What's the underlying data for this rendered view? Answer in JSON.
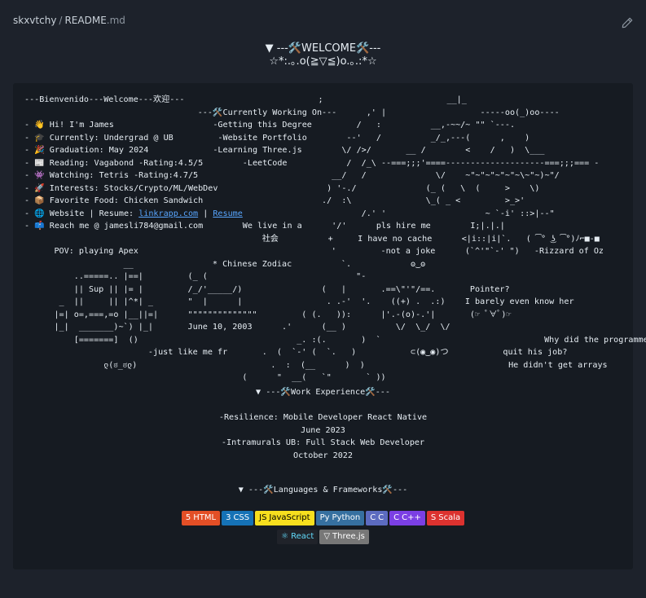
{
  "breadcrumb": {
    "owner": "skxvtchy",
    "separator": "/",
    "file": "README",
    "ext": ".md"
  },
  "header": {
    "title_line": "▼ ---🛠️WELCOME🛠️---",
    "subtitle_line": "☆*:.｡.o(≧▽≦)o.｡.:*☆"
  },
  "art": {
    "line01": "---Bienvenido---Welcome---欢迎---                           ;                         __|_",
    "line02": "                                   ---🛠️Currently Working On---      ,' |                   -----oo(_)oo----",
    "line03": "- 👋 Hi! I'm James                    -Getting this Degree         /   :          __,-~~/~ \"\" `---.",
    "line04": "- 🎓 Currently: Undergrad @ UB         -Website Portfolio        --'   /          _/_,---(      ,    )",
    "line05": "- 🎉 Graduation: May 2024             -Learning Three.js        \\/ />/       __ /        <    /   )  \\___",
    "line06": "- 📰 Reading: Vagabond -Rating:4.5/5        -LeetCode            /  /_\\ --===;;;'====--------------------===;;;=== -",
    "line07": "- 👾 Watching: Tetris -Rating:4.7/5                           __/   /              \\/    ~\"~\"~\"~\"~\"~\\~\"~)~\"/",
    "line08": "- 🚀 Interests: Stocks/Crypto/ML/WebDev                      ) '-./              (_ (   \\  (     >    \\)",
    "line09": "- 📦 Favorite Food: Chicken Sandwich                        ./  :\\               \\_( _ <         >_>'",
    "line10a": "- 🌐 Website | Resume: ",
    "link1": "linkrapp.com",
    "line10b": " | ",
    "link2": "Resume",
    "line10c": "                        /.' '                    ~ `-i' ::>|--\"",
    "line11": "- 📫 Reach me @ jamesli784@gmail.com        We live in a      '/'      pls hire me        I;|.|.|",
    "line12": "                                                社会          +     I have no cache      <|i::|i|`.   ( ͡° ͜ʖ ͡°)ﾉ⌐■-■",
    "line13": "      POV: playing Apex                                       '         -not a joke      (`^'\"`-' \")   -Rizzard of Oz",
    "line14": "                    __                * Chinese Zodiac          `.            ʘ‿ʘ",
    "line15": "          ..=====.. |==|         (_ (                              \"-",
    "line16": "          || Sup || |= |         /_/'_____/)                (   |       .==\\\"'\"/==.       Pointer?",
    "line17": "       _  ||     || |^*| _       \"  |      |                 . .-'  '.    ((+) .  .:)    I barely even know her",
    "line18": "      |=| o=,===,=o |__||=|      \"\"\"\"\"\"\"\"\"\"\"\"\"\"         ( (.   )):      |'.-(o)-.'|       (☞ ﾟ∀ﾟ)☞",
    "line19": "      |_|  _______)~`) |_|       June 10, 2003      .'      (__ )          \\/  \\_/  \\/",
    "line20": "          [=======]  ()                                _. :(.       )  `                                 Why did the programmer",
    "line21": "                         -just like me fr       .  (  `-' (  `.   )           ⊂(◉‿◉)つ           quit his job?",
    "line22": "                ლ(ಠ_ಠლ)                           .  :  (__      )  )                             He didn't get arrays",
    "line23": "                                            (      \"  __(   `\"       ` ))"
  },
  "work": {
    "title": "▼ ---🛠️Work Experience🛠️---",
    "job1": "-Resilience: Mobile Developer React Native",
    "date1": "June 2023",
    "job2": "-Intramurals UB: Full Stack Web Developer",
    "date2": "October 2022"
  },
  "languages": {
    "title": "▼ ---🛠️Languages & Frameworks🛠️---",
    "row1": [
      {
        "label": "HTML",
        "color": "#e34f26",
        "icon": "5"
      },
      {
        "label": "CSS",
        "color": "#1572b6",
        "icon": "3"
      },
      {
        "label": "JavaScript",
        "color": "#f7df1e",
        "text_color": "#000000",
        "icon": "JS"
      },
      {
        "label": "Python",
        "color": "#3670a0",
        "icon": "Py"
      },
      {
        "label": "C",
        "color": "#5c6bc0",
        "icon": "C"
      },
      {
        "label": "C++",
        "color": "#7b3fe4",
        "icon": "C"
      },
      {
        "label": "Scala",
        "color": "#dc322f",
        "icon": "S"
      }
    ],
    "row2": [
      {
        "label": "React",
        "color": "#20232a",
        "text_color": "#61dafb",
        "icon": "⚛"
      },
      {
        "label": "Three.js",
        "color": "#777777",
        "icon": "▽"
      }
    ]
  }
}
